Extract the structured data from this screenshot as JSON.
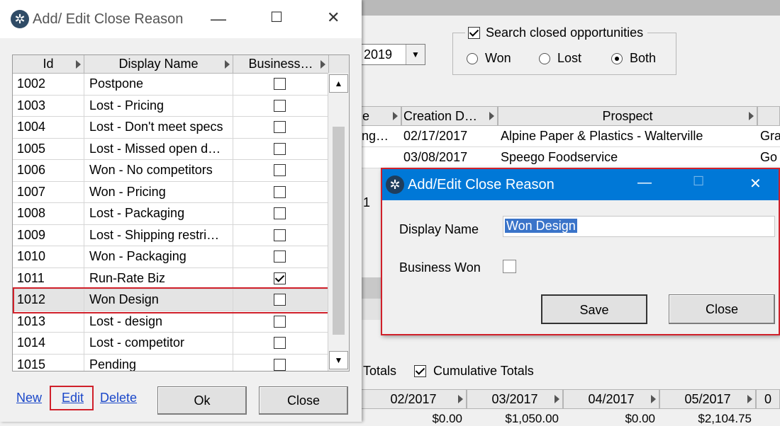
{
  "background": {
    "date_combo_value": "2019",
    "search_group": {
      "label": "Search closed opportunities",
      "radios": [
        {
          "label": "Won",
          "selected": false
        },
        {
          "label": "Lost",
          "selected": false
        },
        {
          "label": "Both",
          "selected": true
        }
      ]
    },
    "grid": {
      "headers": [
        "e",
        "Creation D…",
        "Prospect",
        ""
      ],
      "rows": [
        {
          "col0": "ng…",
          "date": "02/17/2017",
          "prospect": "Alpine Paper & Plastics - Walterville",
          "extra": "Gra"
        },
        {
          "col0": "",
          "date": "03/08/2017",
          "prospect": "Speego Foodservice",
          "extra": "Go"
        }
      ],
      "stray_value": "1"
    },
    "totals": {
      "totals_label": "Totals",
      "cumulative_label": "Cumulative Totals",
      "cumulative_checked": true
    },
    "months": {
      "headers": [
        "02/2017",
        "03/2017",
        "04/2017",
        "05/2017",
        "0"
      ],
      "values": [
        "$0.00",
        "$1,050.00",
        "$0.00",
        "$2,104.75"
      ]
    }
  },
  "list_dialog": {
    "title": "Add/ Edit Close Reason",
    "columns": [
      "Id",
      "Display Name",
      "Business…"
    ],
    "rows": [
      {
        "id": "1002",
        "name": "Postpone",
        "business_won": false
      },
      {
        "id": "1003",
        "name": "Lost - Pricing",
        "business_won": false
      },
      {
        "id": "1004",
        "name": "Lost - Don't meet specs",
        "business_won": false
      },
      {
        "id": "1005",
        "name": "Lost - Missed open d…",
        "business_won": false
      },
      {
        "id": "1006",
        "name": "Won - No competitors",
        "business_won": false
      },
      {
        "id": "1007",
        "name": "Won - Pricing",
        "business_won": false
      },
      {
        "id": "1008",
        "name": "Lost - Packaging",
        "business_won": false
      },
      {
        "id": "1009",
        "name": "Lost - Shipping restri…",
        "business_won": false
      },
      {
        "id": "1010",
        "name": "Won - Packaging",
        "business_won": false
      },
      {
        "id": "1011",
        "name": "Run-Rate Biz",
        "business_won": true
      },
      {
        "id": "1012",
        "name": "Won Design",
        "business_won": false,
        "selected": true
      },
      {
        "id": "1013",
        "name": "Lost - design",
        "business_won": false
      },
      {
        "id": "1014",
        "name": "Lost - competitor",
        "business_won": false
      },
      {
        "id": "1015",
        "name": "Pending",
        "business_won": false
      }
    ],
    "links": {
      "new": "New",
      "edit": "Edit",
      "delete": "Delete"
    },
    "buttons": {
      "ok": "Ok",
      "close": "Close"
    }
  },
  "edit_dialog": {
    "title": "Add/Edit Close Reason",
    "display_name_label": "Display Name",
    "display_name_value": "Won Design",
    "business_won_label": "Business Won",
    "business_won": false,
    "buttons": {
      "save": "Save",
      "close": "Close"
    }
  },
  "colors": {
    "accent": "#0078d7",
    "highlight": "#d0202a",
    "link": "#1a47c9"
  }
}
